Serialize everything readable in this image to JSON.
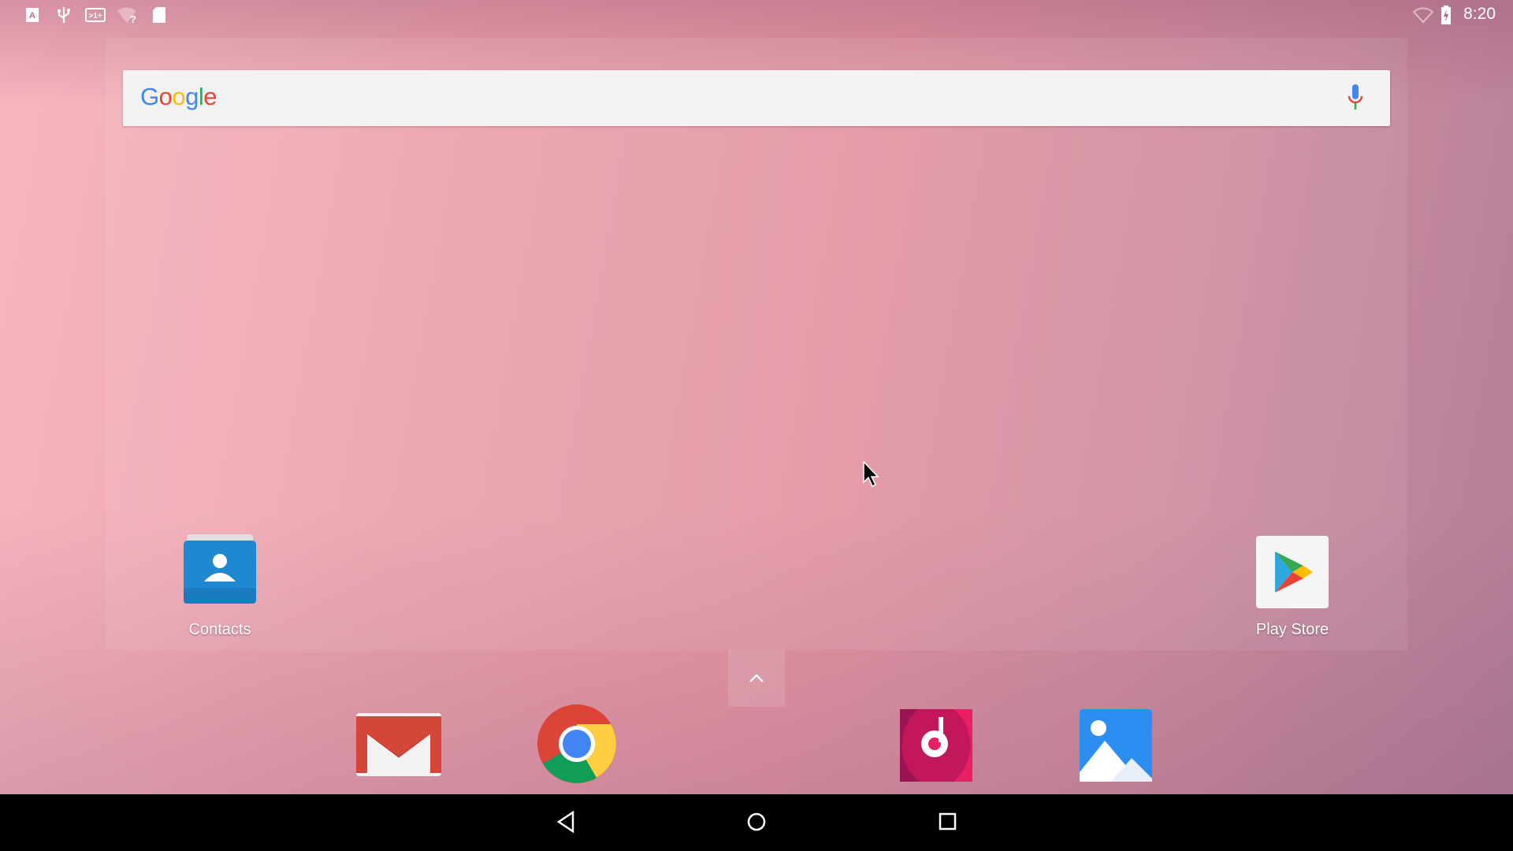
{
  "status_bar": {
    "left_icons": [
      "keyboard-a-icon",
      "usb-icon",
      "battery-saver-plus-icon",
      "wifi-unknown-icon",
      "sd-card-icon"
    ],
    "right_icons": [
      "wifi-icon",
      "battery-charging-icon"
    ],
    "time": "8:20"
  },
  "search_widget": {
    "logo": "Google",
    "mic_icon": "microphone-icon"
  },
  "home_apps": [
    {
      "label": "Contacts",
      "icon": "contacts-icon"
    },
    {
      "label": "Play Store",
      "icon": "play-store-icon"
    }
  ],
  "dock": [
    "gmail-icon",
    "chrome-icon",
    "music-icon",
    "photos-icon"
  ],
  "nav_bar": [
    "back-icon",
    "home-icon",
    "recents-icon"
  ],
  "colors": {
    "google_blue": "#4285F4",
    "google_red": "#EA4335",
    "google_yellow": "#FBBC05",
    "google_green": "#34A853"
  }
}
